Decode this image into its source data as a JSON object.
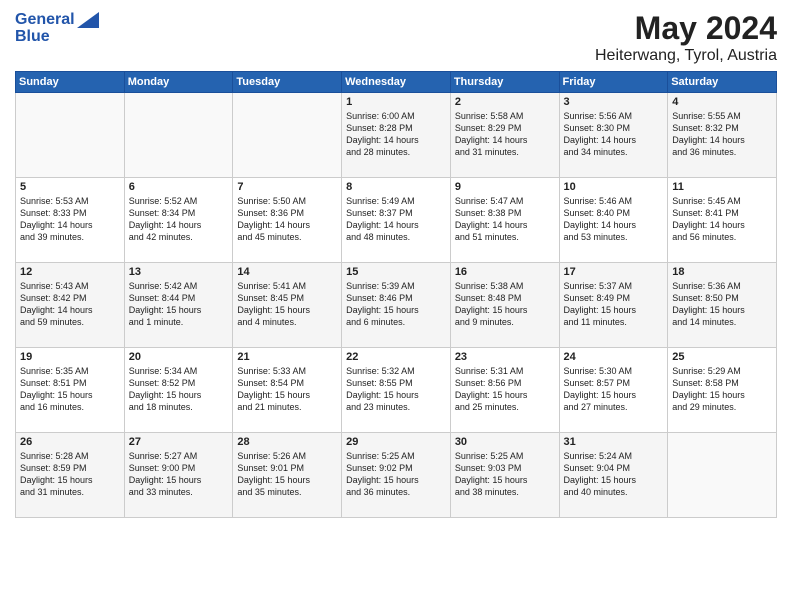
{
  "logo": {
    "line1": "General",
    "line2": "Blue"
  },
  "title": "May 2024",
  "subtitle": "Heiterwang, Tyrol, Austria",
  "days_of_week": [
    "Sunday",
    "Monday",
    "Tuesday",
    "Wednesday",
    "Thursday",
    "Friday",
    "Saturday"
  ],
  "weeks": [
    [
      {
        "day": "",
        "info": ""
      },
      {
        "day": "",
        "info": ""
      },
      {
        "day": "",
        "info": ""
      },
      {
        "day": "1",
        "info": "Sunrise: 6:00 AM\nSunset: 8:28 PM\nDaylight: 14 hours\nand 28 minutes."
      },
      {
        "day": "2",
        "info": "Sunrise: 5:58 AM\nSunset: 8:29 PM\nDaylight: 14 hours\nand 31 minutes."
      },
      {
        "day": "3",
        "info": "Sunrise: 5:56 AM\nSunset: 8:30 PM\nDaylight: 14 hours\nand 34 minutes."
      },
      {
        "day": "4",
        "info": "Sunrise: 5:55 AM\nSunset: 8:32 PM\nDaylight: 14 hours\nand 36 minutes."
      }
    ],
    [
      {
        "day": "5",
        "info": "Sunrise: 5:53 AM\nSunset: 8:33 PM\nDaylight: 14 hours\nand 39 minutes."
      },
      {
        "day": "6",
        "info": "Sunrise: 5:52 AM\nSunset: 8:34 PM\nDaylight: 14 hours\nand 42 minutes."
      },
      {
        "day": "7",
        "info": "Sunrise: 5:50 AM\nSunset: 8:36 PM\nDaylight: 14 hours\nand 45 minutes."
      },
      {
        "day": "8",
        "info": "Sunrise: 5:49 AM\nSunset: 8:37 PM\nDaylight: 14 hours\nand 48 minutes."
      },
      {
        "day": "9",
        "info": "Sunrise: 5:47 AM\nSunset: 8:38 PM\nDaylight: 14 hours\nand 51 minutes."
      },
      {
        "day": "10",
        "info": "Sunrise: 5:46 AM\nSunset: 8:40 PM\nDaylight: 14 hours\nand 53 minutes."
      },
      {
        "day": "11",
        "info": "Sunrise: 5:45 AM\nSunset: 8:41 PM\nDaylight: 14 hours\nand 56 minutes."
      }
    ],
    [
      {
        "day": "12",
        "info": "Sunrise: 5:43 AM\nSunset: 8:42 PM\nDaylight: 14 hours\nand 59 minutes."
      },
      {
        "day": "13",
        "info": "Sunrise: 5:42 AM\nSunset: 8:44 PM\nDaylight: 15 hours\nand 1 minute."
      },
      {
        "day": "14",
        "info": "Sunrise: 5:41 AM\nSunset: 8:45 PM\nDaylight: 15 hours\nand 4 minutes."
      },
      {
        "day": "15",
        "info": "Sunrise: 5:39 AM\nSunset: 8:46 PM\nDaylight: 15 hours\nand 6 minutes."
      },
      {
        "day": "16",
        "info": "Sunrise: 5:38 AM\nSunset: 8:48 PM\nDaylight: 15 hours\nand 9 minutes."
      },
      {
        "day": "17",
        "info": "Sunrise: 5:37 AM\nSunset: 8:49 PM\nDaylight: 15 hours\nand 11 minutes."
      },
      {
        "day": "18",
        "info": "Sunrise: 5:36 AM\nSunset: 8:50 PM\nDaylight: 15 hours\nand 14 minutes."
      }
    ],
    [
      {
        "day": "19",
        "info": "Sunrise: 5:35 AM\nSunset: 8:51 PM\nDaylight: 15 hours\nand 16 minutes."
      },
      {
        "day": "20",
        "info": "Sunrise: 5:34 AM\nSunset: 8:52 PM\nDaylight: 15 hours\nand 18 minutes."
      },
      {
        "day": "21",
        "info": "Sunrise: 5:33 AM\nSunset: 8:54 PM\nDaylight: 15 hours\nand 21 minutes."
      },
      {
        "day": "22",
        "info": "Sunrise: 5:32 AM\nSunset: 8:55 PM\nDaylight: 15 hours\nand 23 minutes."
      },
      {
        "day": "23",
        "info": "Sunrise: 5:31 AM\nSunset: 8:56 PM\nDaylight: 15 hours\nand 25 minutes."
      },
      {
        "day": "24",
        "info": "Sunrise: 5:30 AM\nSunset: 8:57 PM\nDaylight: 15 hours\nand 27 minutes."
      },
      {
        "day": "25",
        "info": "Sunrise: 5:29 AM\nSunset: 8:58 PM\nDaylight: 15 hours\nand 29 minutes."
      }
    ],
    [
      {
        "day": "26",
        "info": "Sunrise: 5:28 AM\nSunset: 8:59 PM\nDaylight: 15 hours\nand 31 minutes."
      },
      {
        "day": "27",
        "info": "Sunrise: 5:27 AM\nSunset: 9:00 PM\nDaylight: 15 hours\nand 33 minutes."
      },
      {
        "day": "28",
        "info": "Sunrise: 5:26 AM\nSunset: 9:01 PM\nDaylight: 15 hours\nand 35 minutes."
      },
      {
        "day": "29",
        "info": "Sunrise: 5:25 AM\nSunset: 9:02 PM\nDaylight: 15 hours\nand 36 minutes."
      },
      {
        "day": "30",
        "info": "Sunrise: 5:25 AM\nSunset: 9:03 PM\nDaylight: 15 hours\nand 38 minutes."
      },
      {
        "day": "31",
        "info": "Sunrise: 5:24 AM\nSunset: 9:04 PM\nDaylight: 15 hours\nand 40 minutes."
      },
      {
        "day": "",
        "info": ""
      }
    ]
  ]
}
